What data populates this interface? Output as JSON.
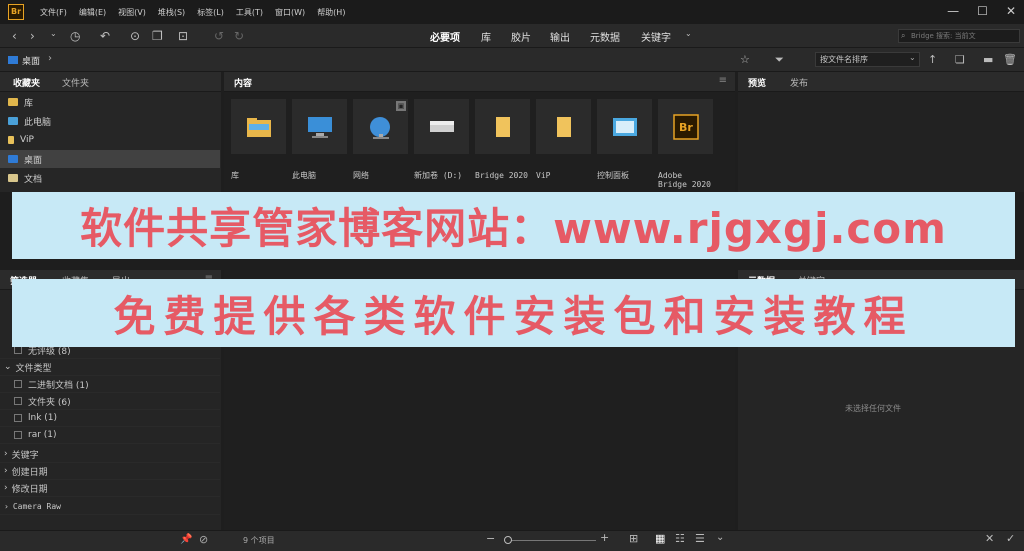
{
  "menu": [
    "文件(F)",
    "编辑(E)",
    "视图(V)",
    "堆栈(S)",
    "标签(L)",
    "工具(T)",
    "窗口(W)",
    "帮助(H)"
  ],
  "workspaces": [
    "必要项",
    "库",
    "胶片",
    "输出",
    "元数据",
    "关键字"
  ],
  "search_placeholder": "Bridge 搜索: 当前文",
  "path": "桌面",
  "sort_label": "按文件名排序",
  "left_tabs": [
    "收藏夹",
    "文件夹"
  ],
  "favorites": [
    {
      "label": "库",
      "color": "#e0b64c"
    },
    {
      "label": "此电脑",
      "color": "#4aa0d8"
    },
    {
      "label": "ViP",
      "color": "#e8c15a"
    },
    {
      "label": "桌面",
      "color": "#2f7bd6"
    },
    {
      "label": "文档",
      "color": "#d8c68c"
    }
  ],
  "content_tab": "内容",
  "items": [
    "库",
    "此电脑",
    "网络",
    "新加卷 (D:)",
    "Bridge 2020",
    "ViP",
    "控制面板",
    "Adobe Bridge 2020"
  ],
  "filter_tabs": [
    "筛选器",
    "收藏集",
    "导出"
  ],
  "filters": {
    "no_rating": "无评级 (8)",
    "file_type_header": "文件类型",
    "file_types": [
      "二进制文档 (1)",
      "文件夹 (6)",
      "lnk (1)",
      "rar (1)"
    ],
    "sections": [
      "关键字",
      "创建日期",
      "修改日期",
      "Camera Raw"
    ]
  },
  "right_tabs": [
    "预览",
    "发布"
  ],
  "meta_tabs": [
    "元数据",
    "关键字"
  ],
  "no_selection": "未选择任何文件",
  "item_count": "9 个项目",
  "banner1": "软件共享管家博客网站：www.rjgxgj.com",
  "banner2": "免费提供各类软件安装包和安装教程"
}
